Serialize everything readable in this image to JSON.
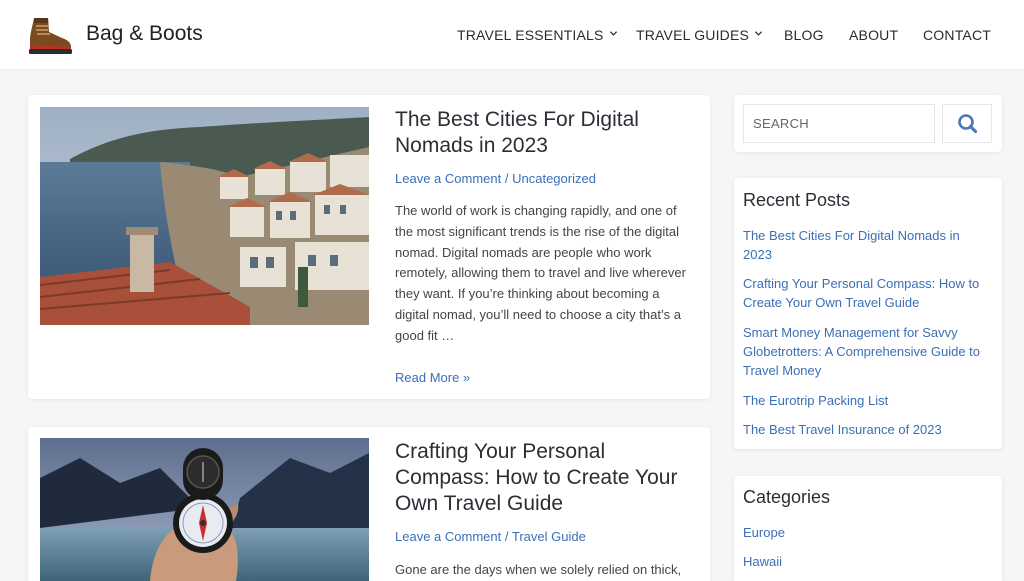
{
  "site": {
    "title": "Bag & Boots"
  },
  "nav": {
    "items": [
      {
        "label": "TRAVEL ESSENTIALS",
        "has_dropdown": true
      },
      {
        "label": "TRAVEL GUIDES",
        "has_dropdown": true
      },
      {
        "label": "BLOG",
        "has_dropdown": false
      },
      {
        "label": "ABOUT",
        "has_dropdown": false
      },
      {
        "label": "CONTACT",
        "has_dropdown": false
      }
    ]
  },
  "posts": [
    {
      "title_line1": "The Best Cities For Digital",
      "title_line2": "Nomads in 2023",
      "comment_link": "Leave a Comment",
      "separator": "/",
      "category": "Uncategorized",
      "excerpt_lines": [
        "The world of work is changing rapidly, and one of",
        "the most significant trends is the rise of the digital",
        "nomad. Digital nomads are people who work",
        "remotely, allowing them to travel and live wherever",
        "they want. If you’re thinking about becoming a",
        "digital nomad, you’ll need to choose a city that’s a",
        "good fit …"
      ],
      "read_more": "Read More »"
    },
    {
      "title_line1": "Crafting Your Personal",
      "title_line2": "Compass: How to Create Your",
      "title_line3": "Own Travel Guide",
      "comment_link": "Leave a Comment",
      "separator": "/",
      "category": "Travel Guide",
      "excerpt_lines": [
        "Gone are the days when we solely relied on thick,"
      ]
    }
  ],
  "sidebar": {
    "search": {
      "placeholder": "SEARCH"
    },
    "recent_posts": {
      "title": "Recent Posts",
      "items": [
        {
          "line1": "The Best Cities For Digital Nomads in",
          "line2": "2023"
        },
        {
          "line1": "Crafting Your Personal Compass: How to",
          "line2": "Create Your Own Travel Guide"
        },
        {
          "line1": "Smart Money Management for Savvy",
          "line2": "Globetrotters: A Comprehensive Guide to",
          "line3": "Travel Money"
        },
        {
          "line1": "The Eurotrip Packing List"
        },
        {
          "line1": "The Best Travel Insurance of 2023"
        }
      ]
    },
    "categories": {
      "title": "Categories",
      "items": [
        "Europe",
        "Hawaii"
      ]
    }
  },
  "colors": {
    "link": "#3b6fb6",
    "background": "#f5f6f8",
    "card": "#ffffff",
    "heading": "#2a2f35"
  },
  "icons": {
    "logo": "hiking-boot-icon",
    "search": "magnifier-icon",
    "dropdown": "chevron-down-icon"
  }
}
